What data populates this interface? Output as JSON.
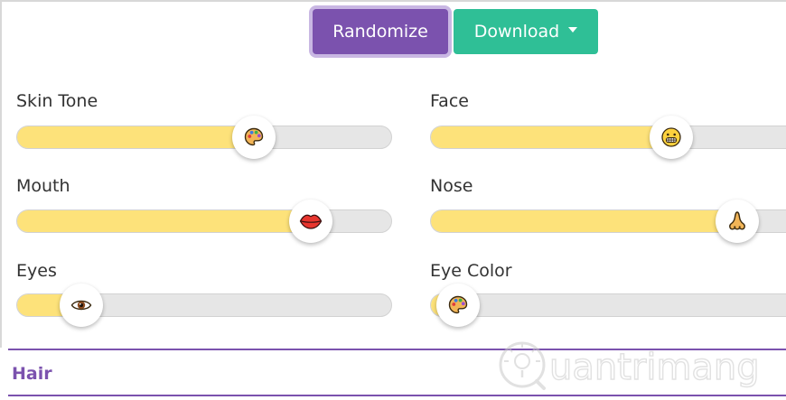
{
  "toolbar": {
    "randomize_label": "Randomize",
    "download_label": "Download"
  },
  "sliders": {
    "skin_tone": {
      "label": "Skin Tone",
      "value_fraction": 0.65
    },
    "face": {
      "label": "Face",
      "value_fraction": 0.66
    },
    "mouth": {
      "label": "Mouth",
      "value_fraction": 0.82
    },
    "nose": {
      "label": "Nose",
      "value_fraction": 0.86
    },
    "eyes": {
      "label": "Eyes",
      "value_fraction": 0.13
    },
    "eye_color": {
      "label": "Eye Color",
      "value_fraction": 0.02
    }
  },
  "section": {
    "hair_label": "Hair"
  },
  "watermark": {
    "text": "uantrimang"
  },
  "colors": {
    "accent_purple": "#7b52ae",
    "accent_teal": "#2fbf96",
    "slider_fill": "#fde27a",
    "slider_track": "#e6e6e6"
  },
  "icons": {
    "skin_tone": "palette-icon",
    "face": "grinning-face-icon",
    "mouth": "lips-icon",
    "nose": "nose-icon",
    "eyes": "eye-icon",
    "eye_color": "palette-icon"
  }
}
